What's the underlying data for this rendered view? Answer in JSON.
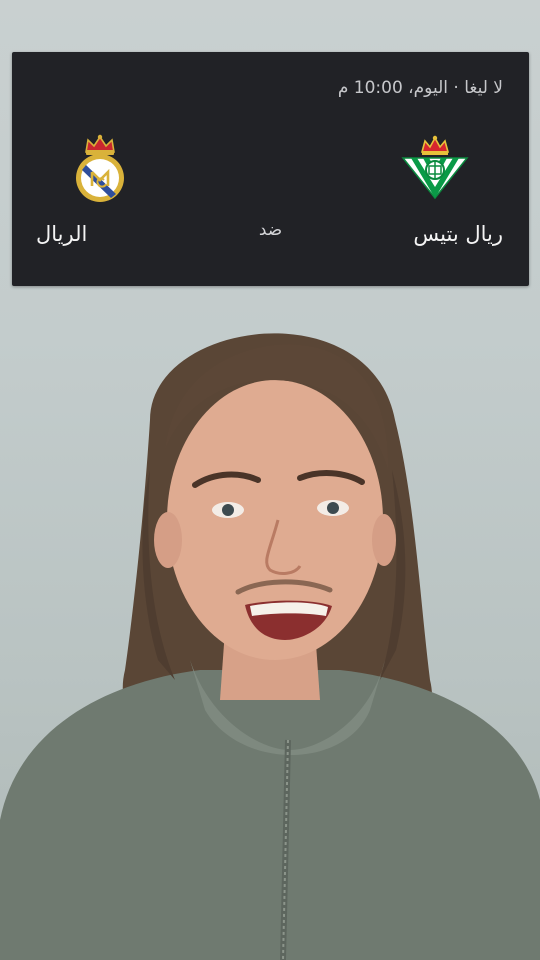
{
  "match": {
    "meta": "لا ليغا · اليوم، 10:00 م",
    "home_team": {
      "name": "ريال بتيس",
      "crest_icon": "real-betis-crest-icon"
    },
    "away_team": {
      "name": "الريال",
      "crest_icon": "real-madrid-crest-icon"
    },
    "vs_label": "ضد"
  },
  "colors": {
    "card_background": "#212226",
    "betis_green": "#0a9a47",
    "madrid_gold": "#d9b23a",
    "background": "#c3cccc"
  }
}
